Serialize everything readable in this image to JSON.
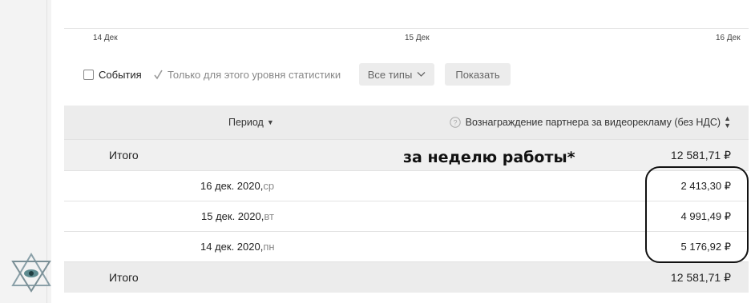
{
  "chart": {
    "x_ticks": [
      "14 Дек",
      "15 Дек",
      "16 Дек"
    ]
  },
  "filters": {
    "events_label": "События",
    "events_checked": false,
    "level_label": "Только для этого уровня статистики",
    "level_checked": true,
    "types_select": "Все типы",
    "show_button": "Показать"
  },
  "table": {
    "period_header": "Период",
    "reward_header": "Вознаграждение партнера за видеорекламу (без НДС)",
    "total_label": "Итого",
    "total_value": "12 581,71 ₽",
    "rows": [
      {
        "date": "16 дек. 2020, ",
        "weekday": "ср",
        "value": "2 413,30 ₽"
      },
      {
        "date": "15 дек. 2020, ",
        "weekday": "вт",
        "value": "4 991,49 ₽"
      },
      {
        "date": "14 дек. 2020, ",
        "weekday": "пн",
        "value": "5 176,92 ₽"
      }
    ],
    "footer_label": "Итого",
    "footer_value": "12 581,71 ₽"
  },
  "annotation": {
    "text": "за неделю работы*",
    "circle_color": "#111111"
  },
  "colors": {
    "header_bg": "#ececec",
    "muted_text": "#888888"
  }
}
